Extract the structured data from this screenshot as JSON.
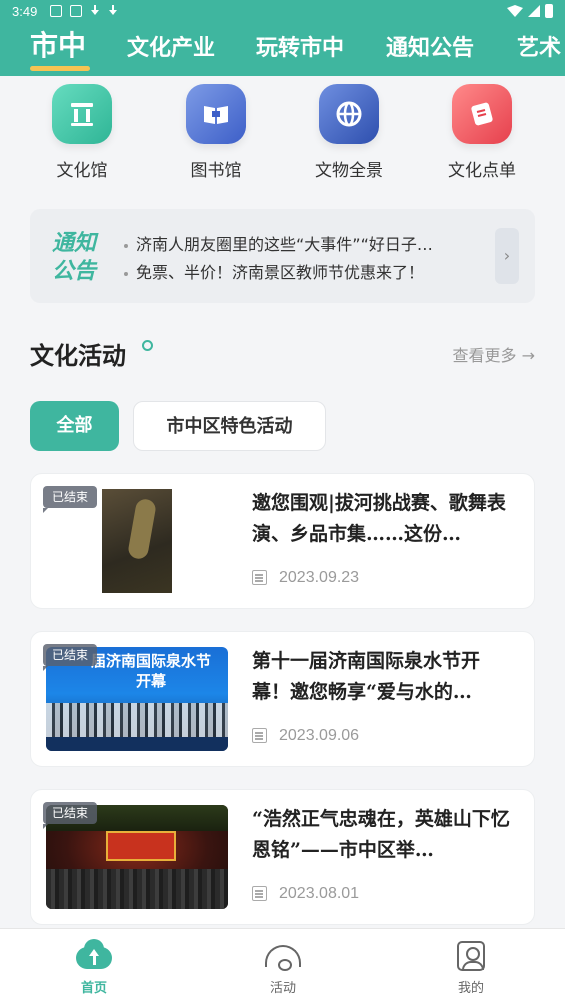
{
  "status_bar": {
    "time": "3:49"
  },
  "top_nav": {
    "tabs": [
      "市中",
      "文化产业",
      "玩转市中",
      "通知公告",
      "艺术"
    ],
    "active_index": 0,
    "colors": {
      "background": "#3fb69f",
      "underline": "#f6c453"
    }
  },
  "quick_links": [
    {
      "label": "文化馆",
      "icon": "museum-icon"
    },
    {
      "label": "图书馆",
      "icon": "book-icon"
    },
    {
      "label": "文物全景",
      "icon": "globe-icon"
    },
    {
      "label": "文化点单",
      "icon": "ticket-icon"
    }
  ],
  "notice": {
    "logo_line1": "通知",
    "logo_line2": "公告",
    "items": [
      "济南人朋友圈里的这些“大事件”“好日子…",
      "免票、半价！济南景区教师节优惠来了！"
    ]
  },
  "section": {
    "title": "文化活动",
    "more": "查看更多 →"
  },
  "filters": [
    "全部",
    "市中区特色活动"
  ],
  "activities": [
    {
      "badge": "已结束",
      "title": "邀您围观|拔河挑战赛、歌舞表演、乡品市集……这份…",
      "date": "2023.09.23"
    },
    {
      "badge": "已结束",
      "title": "第十一届济南国际泉水节开幕！邀您畅享“爱与水的…",
      "date": "2023.09.06",
      "thumb_text": "届济南国际泉水节\n开幕"
    },
    {
      "badge": "已结束",
      "title": "“浩然正气忠魂在，英雄山下忆恩铭”——市中区举…",
      "date": "2023.08.01"
    }
  ],
  "bottom_tabs": [
    {
      "label": "首页",
      "icon": "home-cloud-icon",
      "active": true
    },
    {
      "label": "活动",
      "icon": "fan-icon",
      "active": false
    },
    {
      "label": "我的",
      "icon": "profile-icon",
      "active": false
    }
  ]
}
